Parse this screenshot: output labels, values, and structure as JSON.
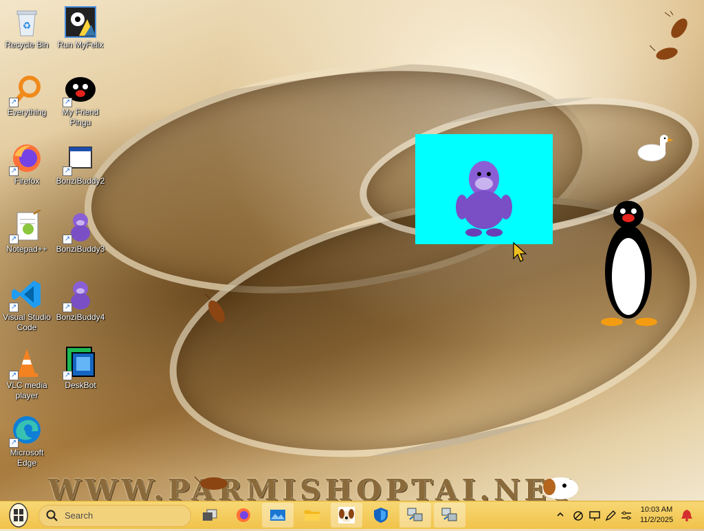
{
  "desktop_icons": [
    {
      "label": "Recycle Bin"
    },
    {
      "label": "Run MyFelix"
    },
    {
      "label": "Everything"
    },
    {
      "label": "My Friend Pingu"
    },
    {
      "label": "Firefox"
    },
    {
      "label": "BonziBuddy2"
    },
    {
      "label": "Notepad++"
    },
    {
      "label": "BonziBuddy3"
    },
    {
      "label": "Visual Studio Code"
    },
    {
      "label": "BonziBuddy4"
    },
    {
      "label": "VLC media player"
    },
    {
      "label": "DeskBot"
    },
    {
      "label": "Microsoft Edge"
    }
  ],
  "wallpaper": {
    "watermark": "WWW.PARMISHOPTAI.NET"
  },
  "taskbar": {
    "search_placeholder": "Search",
    "clock_time": "10:03 AM",
    "clock_date": "11/2/2025",
    "apps": [
      "task-view",
      "firefox",
      "photos",
      "file-explorer",
      "buddy",
      "defender",
      "network-tool-1",
      "network-tool-2"
    ]
  },
  "colors": {
    "taskbar": "#f1c34a",
    "bonzi_window": "#00ffff",
    "bonzi_purple": "#8a5fd6"
  }
}
